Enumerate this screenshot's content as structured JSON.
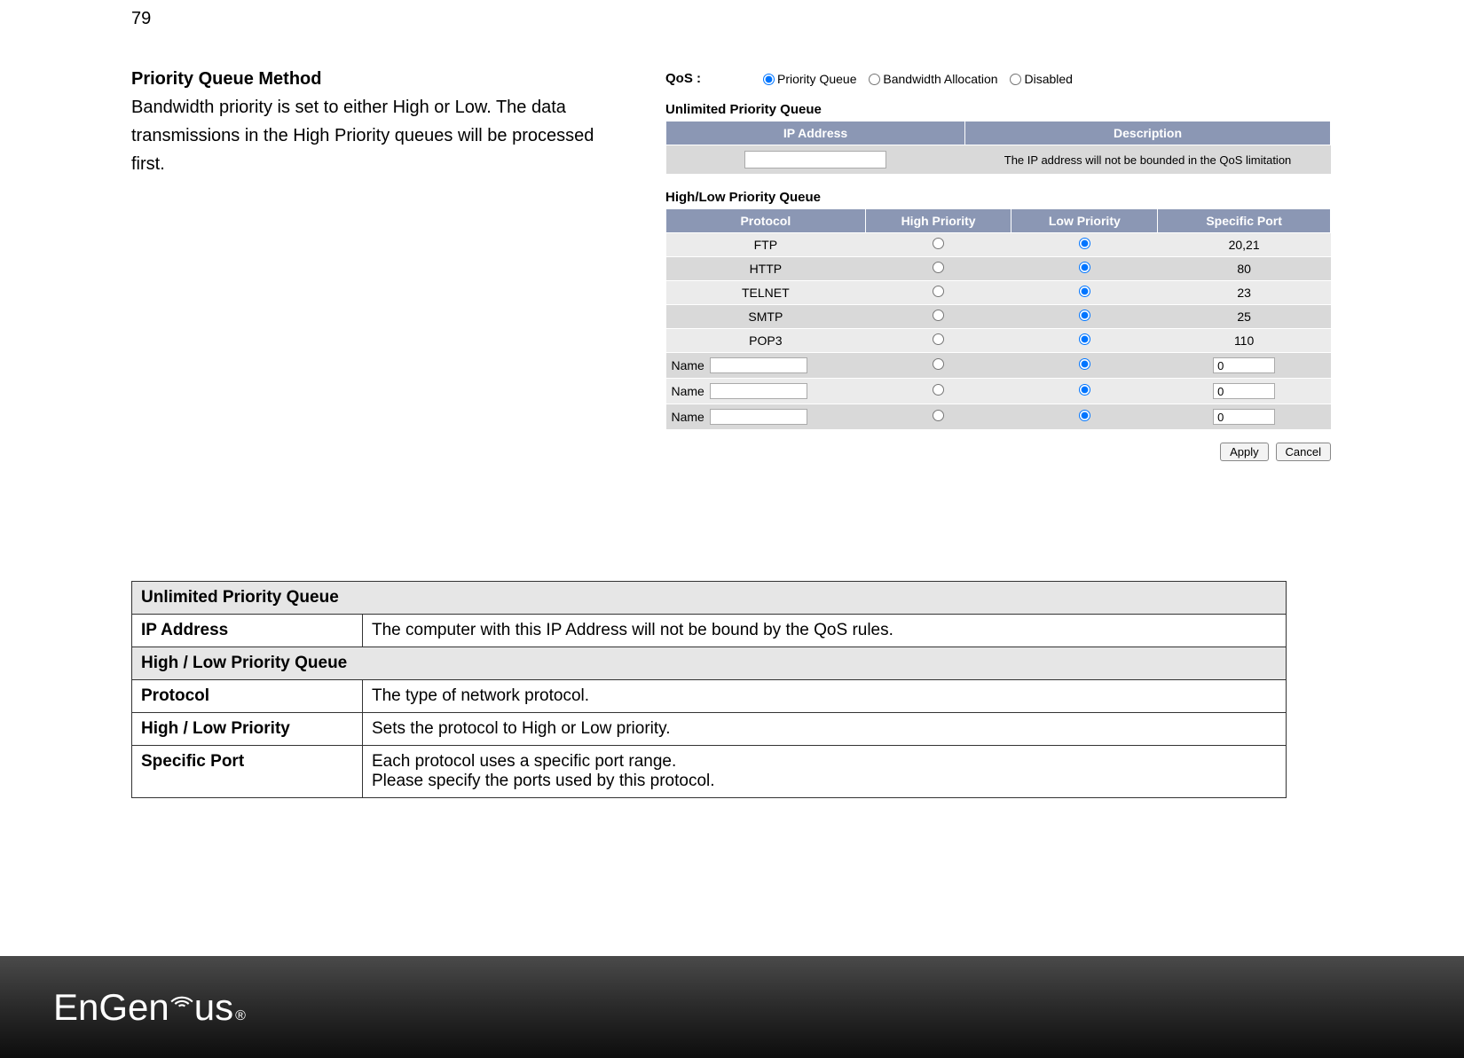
{
  "page_number": "79",
  "heading": "Priority Queue Method",
  "intro": "Bandwidth priority is set to either High or Low. The data transmissions in the High Priority queues will be processed first.",
  "qos": {
    "label": "QoS :",
    "options": [
      "Priority Queue",
      "Bandwidth Allocation",
      "Disabled"
    ],
    "selected": "Priority Queue"
  },
  "upq": {
    "title": "Unlimited Priority Queue",
    "headers": {
      "ip": "IP Address",
      "desc": "Description"
    },
    "ip_value": "",
    "desc_value": "The IP address will not be bounded in the QoS limitation"
  },
  "hlpq": {
    "title": "High/Low Priority Queue",
    "headers": {
      "protocol": "Protocol",
      "high": "High Priority",
      "low": "Low Priority",
      "port": "Specific Port"
    },
    "rows": [
      {
        "protocol": "FTP",
        "selected": "low",
        "port": "20,21",
        "editable": false
      },
      {
        "protocol": "HTTP",
        "selected": "low",
        "port": "80",
        "editable": false
      },
      {
        "protocol": "TELNET",
        "selected": "low",
        "port": "23",
        "editable": false
      },
      {
        "protocol": "SMTP",
        "selected": "low",
        "port": "25",
        "editable": false
      },
      {
        "protocol": "POP3",
        "selected": "low",
        "port": "110",
        "editable": false
      },
      {
        "protocol": "",
        "name_label": "Name",
        "selected": "low",
        "port": "0",
        "editable": true
      },
      {
        "protocol": "",
        "name_label": "Name",
        "selected": "low",
        "port": "0",
        "editable": true
      },
      {
        "protocol": "",
        "name_label": "Name",
        "selected": "low",
        "port": "0",
        "editable": true
      }
    ],
    "name_label": "Name"
  },
  "buttons": {
    "apply": "Apply",
    "cancel": "Cancel"
  },
  "doc_table": {
    "r0": "Unlimited Priority Queue",
    "r1_label": "IP Address",
    "r1_desc": "The computer with this IP Address will not be bound by the QoS rules.",
    "r2": "High / Low Priority Queue",
    "r3_label": "Protocol",
    "r3_desc": "The type of network protocol.",
    "r4_label": "High / Low Priority",
    "r4_desc": "Sets the protocol to High or Low priority.",
    "r5_label": "Specific Port",
    "r5_desc_a": "Each protocol uses a specific port range.",
    "r5_desc_b": "Please specify the ports used by this protocol."
  },
  "logo": {
    "part1": "EnGen",
    "part2": "us",
    "reg": "®"
  }
}
